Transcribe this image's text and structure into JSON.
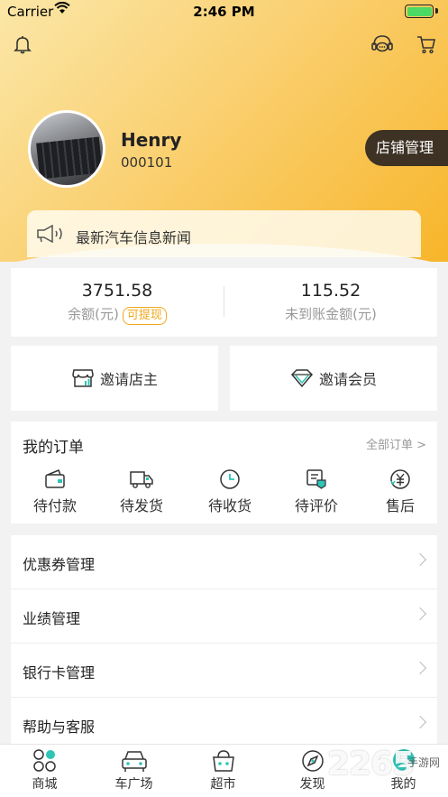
{
  "status_bar": {
    "carrier": "Carrier",
    "time": "2:46 PM"
  },
  "header": {
    "user_name": "Henry",
    "user_id": "000101",
    "shop_button": "店铺管理",
    "news_text": "最新汽车信息新闻"
  },
  "balance": {
    "amount": "3751.58",
    "amount_label": "余额(元)",
    "withdraw_tag": "可提现",
    "pending": "115.52",
    "pending_label": "未到账金额(元)"
  },
  "invite": {
    "shopkeeper": "邀请店主",
    "member": "邀请会员"
  },
  "orders": {
    "title": "我的订单",
    "all_link": "全部订单 >",
    "items": [
      "待付款",
      "待发货",
      "待收货",
      "待评价",
      "售后"
    ]
  },
  "menu": [
    "优惠券管理",
    "业绩管理",
    "银行卡管理",
    "帮助与客服"
  ],
  "tabs": [
    "商城",
    "车广场",
    "超市",
    "发现",
    "我的"
  ],
  "watermark": {
    "brand": "2265",
    "sub": "手游网"
  },
  "colors": {
    "accent": "#f7b52a",
    "dark_button": "#3d3224",
    "tag": "#f0a81c",
    "active_tab": "#2ec4b6"
  }
}
